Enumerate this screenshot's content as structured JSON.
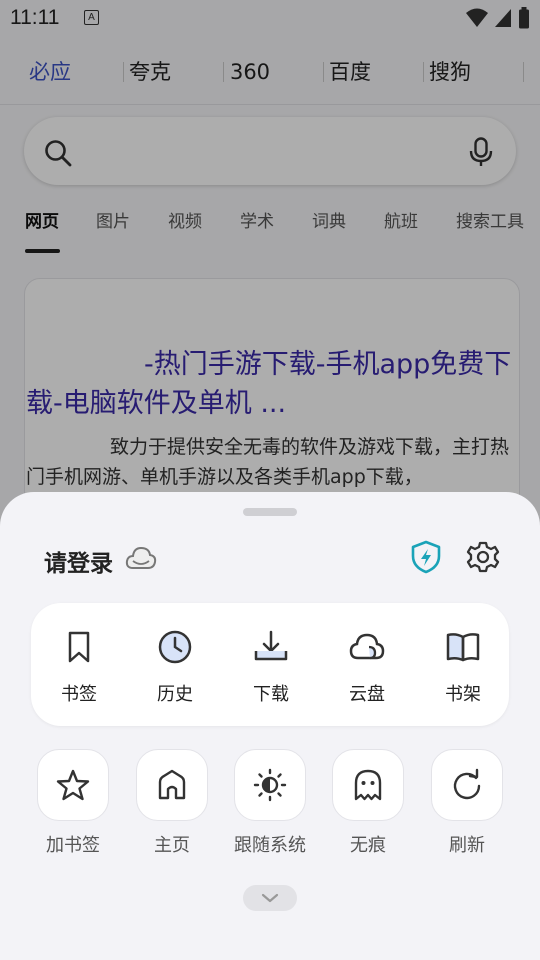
{
  "status": {
    "time": "11:11",
    "notif_letter": "A"
  },
  "engines": [
    "必应",
    "夸克",
    "360",
    "百度",
    "搜狗"
  ],
  "tabs": [
    "网页",
    "图片",
    "视频",
    "学术",
    "词典",
    "航班",
    "搜索工具"
  ],
  "result": {
    "title": "-热门手游下载-手机app免费下载-电脑软件及单机 ...",
    "desc": "致力于提供安全无毒的软件及游戏下载，主打热门手机网游、单机手游以及各类手机app下载，"
  },
  "sheet": {
    "login_label": "请登录",
    "quick_items": [
      {
        "label": "书签",
        "icon": "bookmark-icon"
      },
      {
        "label": "历史",
        "icon": "history-clock-icon"
      },
      {
        "label": "下载",
        "icon": "download-icon"
      },
      {
        "label": "云盘",
        "icon": "cloud-drive-icon"
      },
      {
        "label": "书架",
        "icon": "bookshelf-icon"
      }
    ],
    "actions": [
      {
        "label": "加书签",
        "icon": "star-icon"
      },
      {
        "label": "主页",
        "icon": "home-icon"
      },
      {
        "label": "跟随系统",
        "icon": "theme-sun-icon"
      },
      {
        "label": "无痕",
        "icon": "incognito-ghost-icon"
      },
      {
        "label": "刷新",
        "icon": "refresh-icon"
      }
    ]
  },
  "colors": {
    "accent": "#3c52c4",
    "shield": "#1aa3b8",
    "link": "#3a2aa8"
  }
}
